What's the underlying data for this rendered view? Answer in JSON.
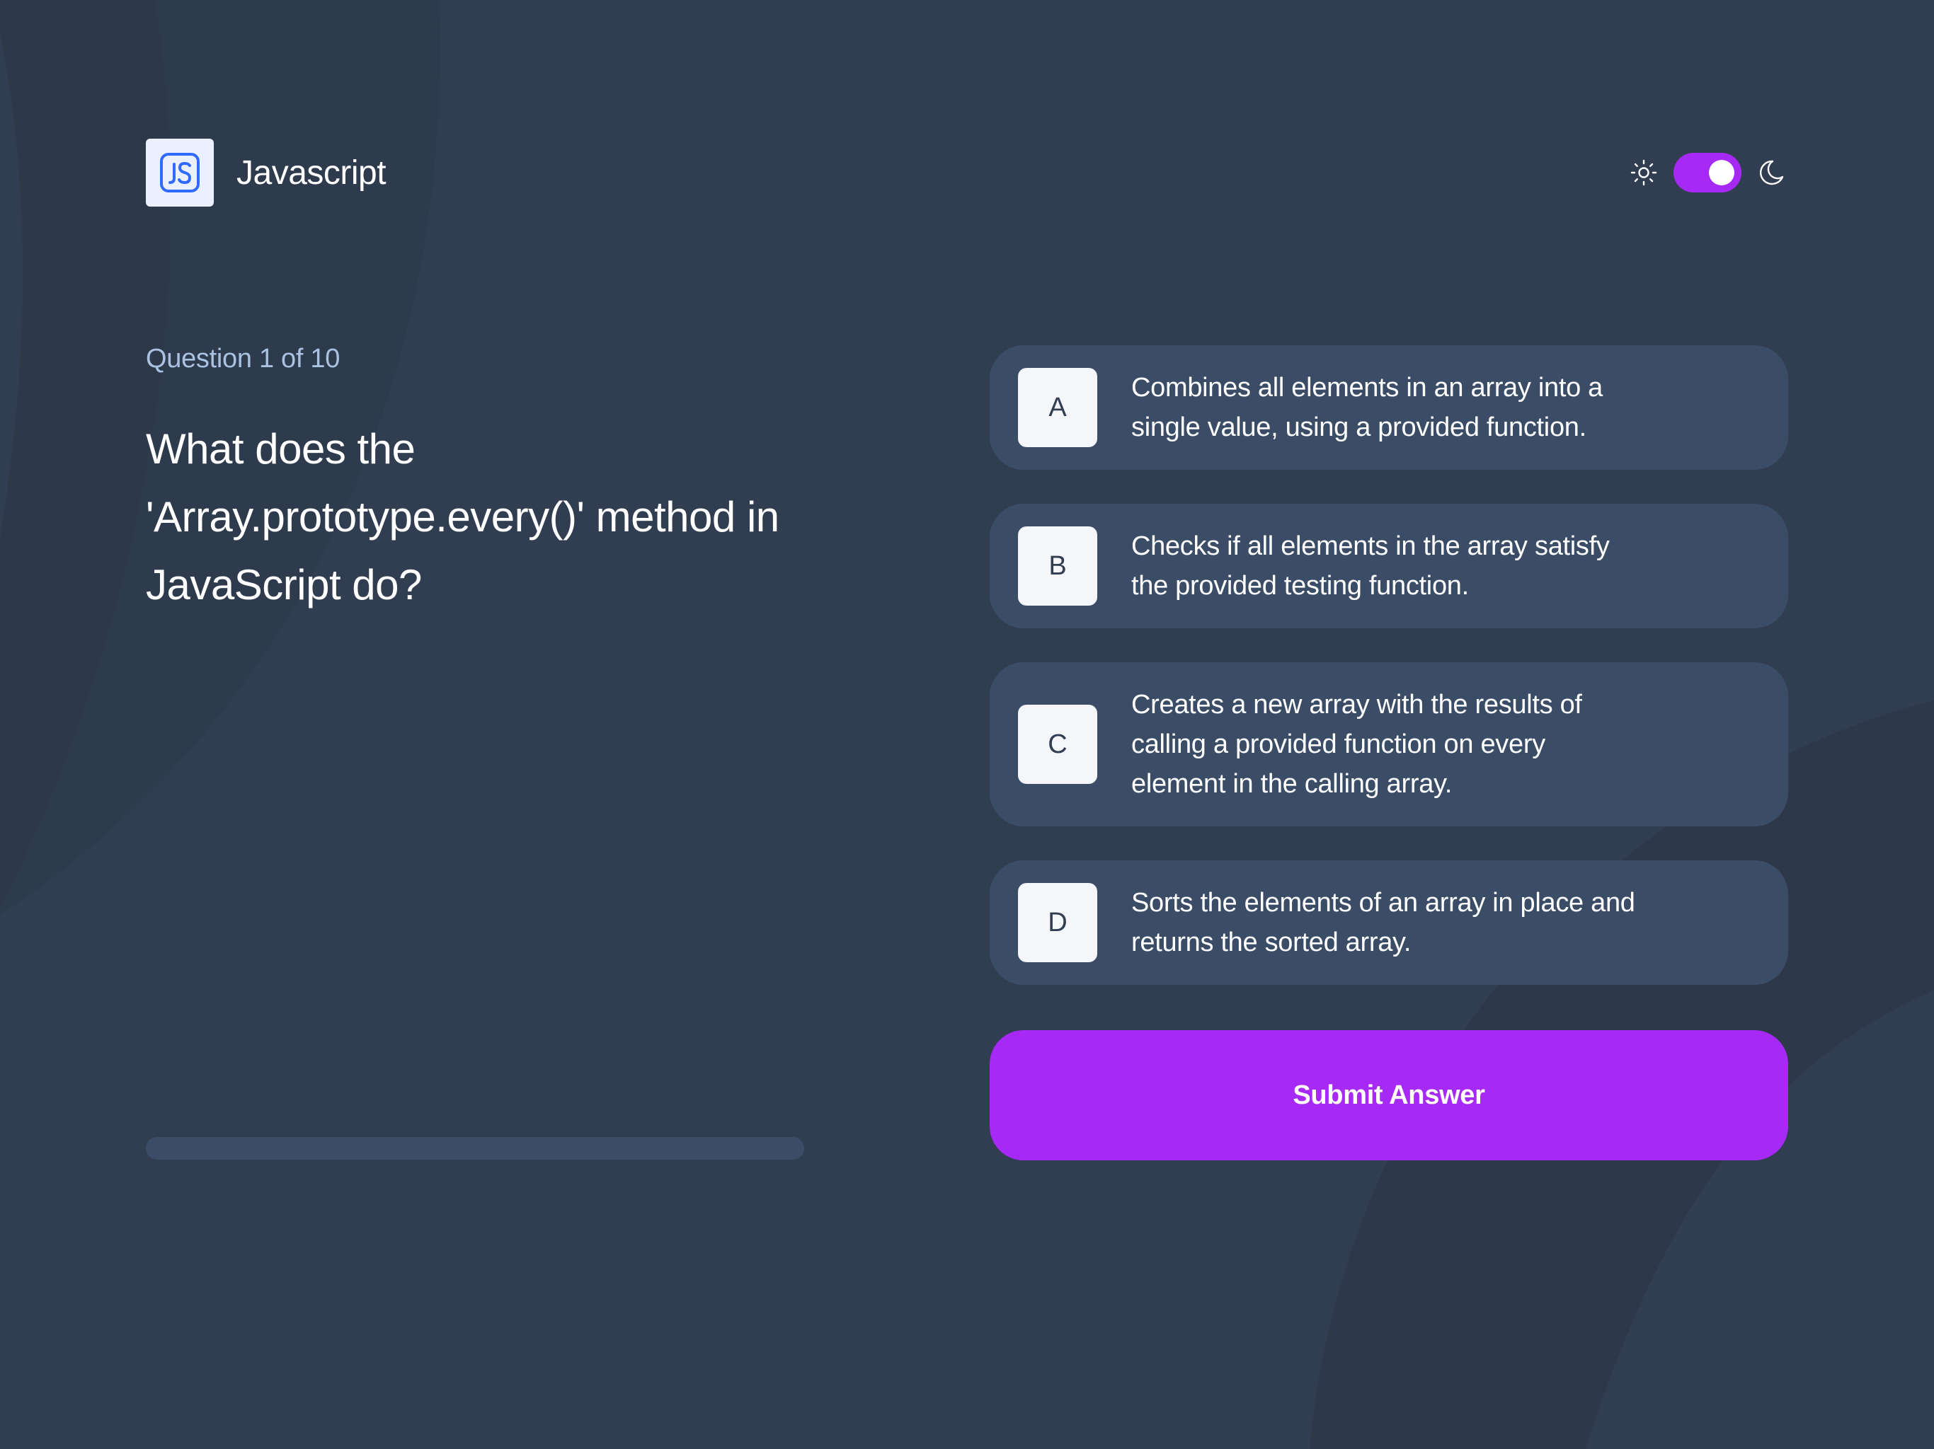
{
  "header": {
    "subject_title": "Javascript",
    "subject_icon": "js-icon",
    "theme": {
      "light_icon": "sun-icon",
      "dark_icon": "moon-icon",
      "dark_mode_enabled": true
    }
  },
  "question": {
    "counter": "Question 1 of 10",
    "text": "What does the 'Array.prototype.every()' method in JavaScript do?",
    "progress_fraction": 0.0
  },
  "options": [
    {
      "letter": "A",
      "text": "Combines all elements in an array into a single value, using a provided function."
    },
    {
      "letter": "B",
      "text": "Checks if all elements in the array satisfy the provided testing function."
    },
    {
      "letter": "C",
      "text": "Creates a new array with the results of calling a provided function on every element in the calling array."
    },
    {
      "letter": "D",
      "text": "Sorts the elements of an array in place and returns the sorted array."
    }
  ],
  "submit_label": "Submit Answer",
  "colors": {
    "background": "#313e51",
    "card": "#3b4d66",
    "accent": "#a729f5",
    "muted_text": "#abc1e1",
    "letter_tile": "#f4f6fa",
    "js_icon_bg": "#ebf0ff",
    "js_icon_stroke": "#306aff"
  }
}
